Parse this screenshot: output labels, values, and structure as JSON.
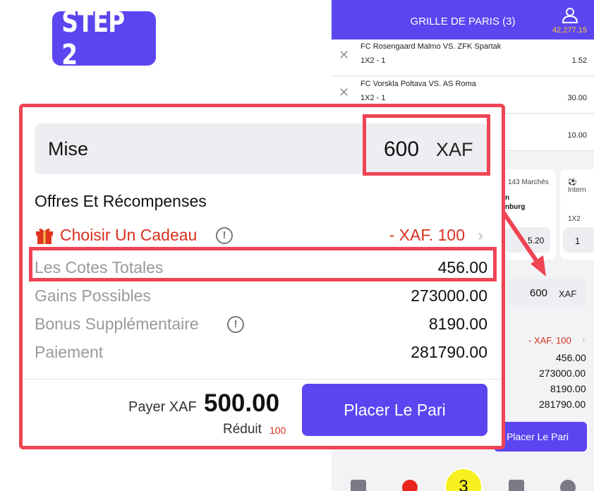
{
  "step_badge": "STEP 2",
  "background_screen": {
    "header_title": "GRILLE DE PARIS (3)",
    "balance": "42,277.15",
    "bets": [
      {
        "match": "FC Rosengaard Malmo VS. ZFK Spartak",
        "market": "1X2 - 1",
        "odd": "1.52"
      },
      {
        "match": "FC Vorskla Poltava VS. AS Roma",
        "market": "1X2 - 1",
        "odd": "30.00"
      },
      {
        "match": "",
        "market": "",
        "odd": "10.00"
      }
    ],
    "cards": {
      "markets_label": "143 Marchés",
      "team_fragment_1": "n",
      "team_fragment_2": "nburg",
      "odd": "5.20",
      "intl_label": "Intern",
      "market": "1X2",
      "pick": "1"
    },
    "stake_value": "600",
    "stake_currency": "XAF",
    "gift_value": "- XAF. 100",
    "totals": [
      "456.00",
      "273000.00",
      "8190.00",
      "281790.00"
    ],
    "place_bet_label": "Placer Le Pari",
    "nav_center_count": "3"
  },
  "panel": {
    "stake_label": "Mise",
    "stake_value": "600",
    "stake_currency": "XAF",
    "offers_title": "Offres Et Récompenses",
    "gift_label": "Choisir Un Cadeau",
    "gift_value": "- XAF. 100",
    "info_symbol": "!",
    "total_odds_label": "Les Cotes Totales",
    "total_odds_value": "456.00",
    "potential_winnings_label": "Gains Possibles",
    "potential_winnings_value": "273000.00",
    "extra_bonus_label": "Bonus Supplémentaire",
    "extra_bonus_value": "8190.00",
    "payment_label": "Paiement",
    "payment_value": "281790.00",
    "pay_label": "Payer XAF",
    "pay_amount": "500.00",
    "reduced_label": "Réduit",
    "reduced_value": "100",
    "place_bet_label": "Placer Le Pari"
  },
  "colors": {
    "accent": "#5b45f0",
    "highlight": "#ef4454",
    "discount": "#d8301e",
    "balance": "#ffcc33",
    "nav_center": "#f7ef20"
  }
}
